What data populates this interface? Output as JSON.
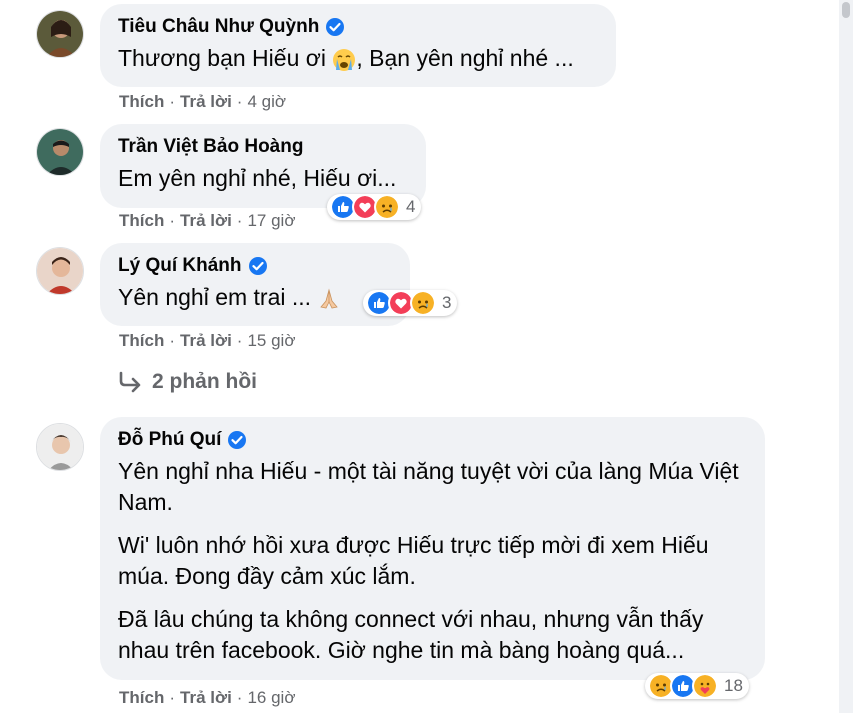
{
  "comments": [
    {
      "name": "Tiêu Châu Như Quỳnh",
      "verified": true,
      "text_before_emoji": "Thương bạn Hiếu ơi ",
      "emoji": "crying-face",
      "text_after_emoji": ", Bạn yên nghỉ nhé ...",
      "like_label": "Thích",
      "reply_label": "Trả lời",
      "time": "4 giờ"
    },
    {
      "name": "Trần Việt Bảo Hoàng",
      "verified": false,
      "text": "Em yên nghỉ nhé, Hiếu ơi...",
      "like_label": "Thích",
      "reply_label": "Trả lời",
      "time": "17 giờ",
      "reactions": {
        "icons": [
          "like",
          "love",
          "sad"
        ],
        "count": "4"
      }
    },
    {
      "name": "Lý Quí Khánh",
      "verified": true,
      "text": "Yên nghỉ em trai ... ",
      "emoji": "folded-hands",
      "like_label": "Thích",
      "reply_label": "Trả lời",
      "time": "15 giờ",
      "reactions": {
        "icons": [
          "like",
          "love",
          "sad"
        ],
        "count": "3"
      }
    },
    {
      "name": "Đỗ Phú Quí",
      "verified": true,
      "paragraphs": [
        "Yên nghỉ nha Hiếu - một tài năng tuyệt vời của làng Múa Việt Nam.",
        "Wi' luôn nhớ hồi xưa được Hiếu trực tiếp mời đi xem Hiếu múa. Đong đầy cảm xúc lắm.",
        "Đã lâu chúng ta không connect với nhau, nhưng vẫn thấy nhau trên facebook. Giờ nghe tin mà bàng hoàng quá..."
      ],
      "like_label": "Thích",
      "reply_label": "Trả lời",
      "time": "16 giờ",
      "reactions": {
        "icons": [
          "sad",
          "like",
          "care"
        ],
        "count": "18"
      }
    }
  ],
  "replies_link": {
    "label": "2 phản hồi"
  },
  "colors": {
    "bubble": "#f0f2f5",
    "verified": "#1877f2",
    "meta": "#65676b",
    "like": "#1877f2",
    "love": "#f33e58",
    "sad": "#f7b125"
  }
}
